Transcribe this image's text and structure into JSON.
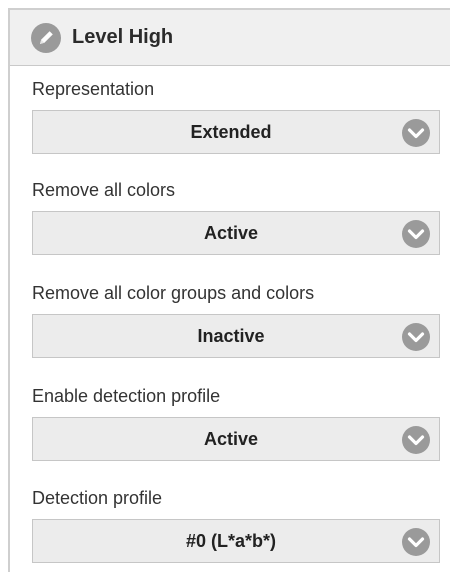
{
  "header": {
    "title": "Level High",
    "icon": "pencil-edit-icon"
  },
  "fields": [
    {
      "label": "Representation",
      "value": "Extended"
    },
    {
      "label": "Remove all colors",
      "value": "Active"
    },
    {
      "label": "Remove all color groups and colors",
      "value": "Inactive"
    },
    {
      "label": "Enable detection profile",
      "value": "Active"
    },
    {
      "label": "Detection profile",
      "value": "#0 (L*a*b*)"
    }
  ],
  "colors": {
    "header_bg": "#f0f0f0",
    "select_bg": "#ececec",
    "icon_gray": "#9a9a9a"
  }
}
